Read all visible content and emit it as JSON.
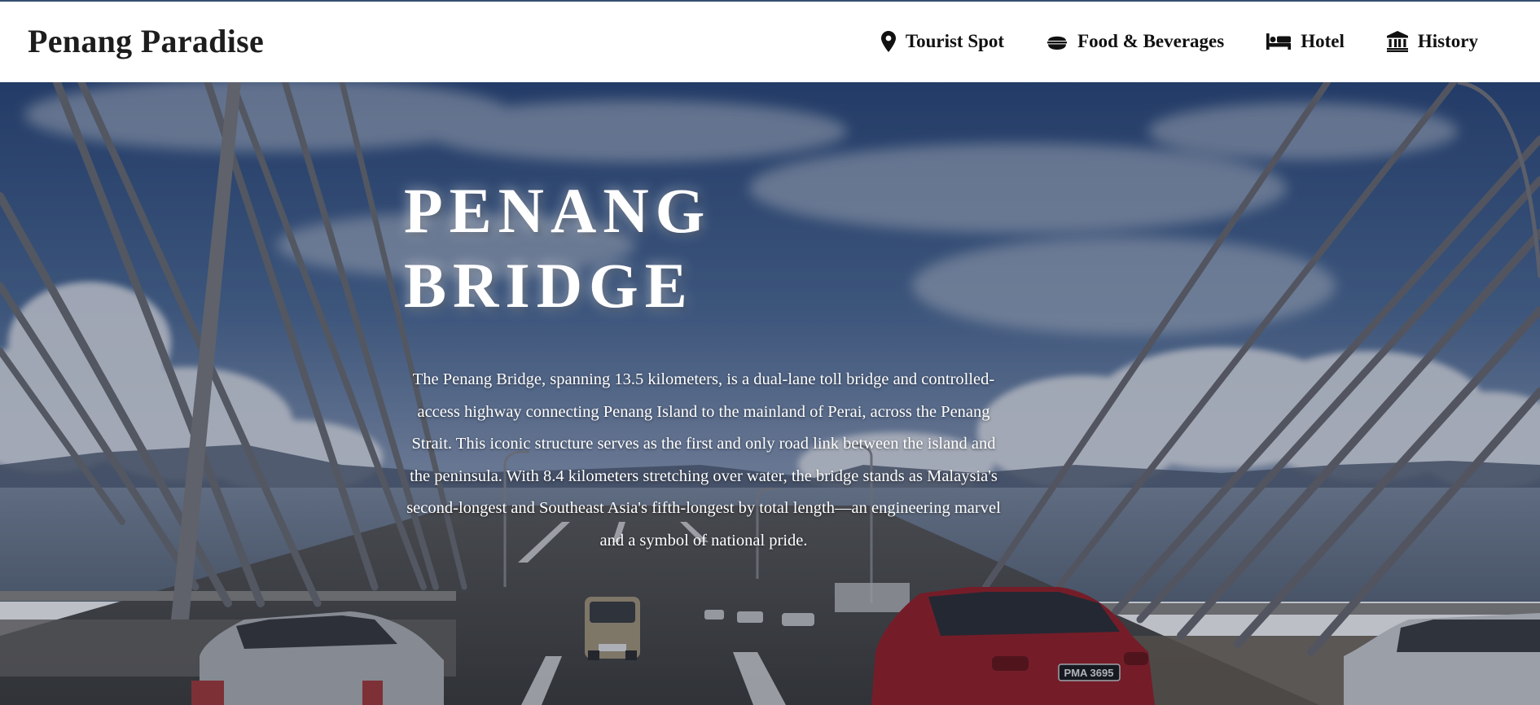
{
  "header": {
    "brand": "Penang Paradise",
    "nav": [
      {
        "label": "Tourist Spot",
        "icon": "map-pin-icon"
      },
      {
        "label": "Food & Beverages",
        "icon": "bowl-icon"
      },
      {
        "label": "Hotel",
        "icon": "bed-icon"
      },
      {
        "label": "History",
        "icon": "landmark-icon"
      }
    ]
  },
  "hero": {
    "title_line1": "PENANG",
    "title_line2": "BRIDGE",
    "description": "The Penang Bridge, spanning 13.5 kilometers, is a dual-lane toll bridge and controlled-access highway connecting Penang Island to the mainland of Perai, across the Penang Strait. This iconic structure serves as the first and only road link between the island and the peninsula. With 8.4 kilometers stretching over water, the bridge stands as Malaysia's second-longest and Southeast Asia's fifth-longest by total length—an engineering marvel and a symbol of national pride.",
    "license_plate": "PMA 3695"
  },
  "colors": {
    "header_bg": "#ffffff",
    "top_border": "#34506f",
    "brand_text": "#1d1d1d",
    "hero_text": "#ffffff"
  }
}
